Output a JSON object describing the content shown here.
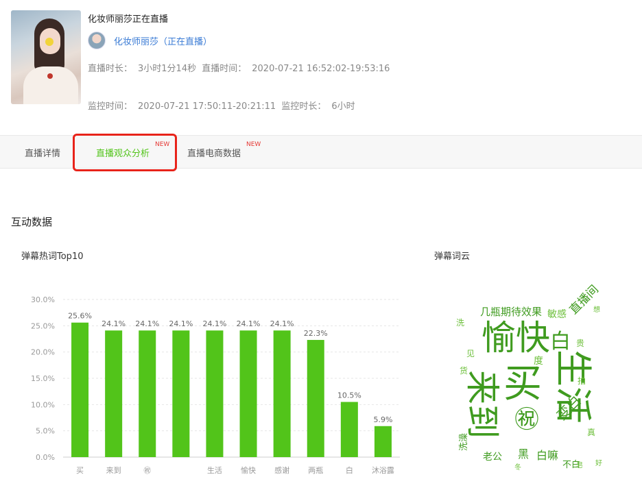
{
  "header": {
    "title": "化妆师丽莎正在直播",
    "anchor_name": "化妆师丽莎（正在直播）",
    "live_duration_label": "直播时长：",
    "live_duration": "3小时1分14秒",
    "live_time_label": "直播时间：",
    "live_time": "2020-07-21 16:52:02-19:53:16",
    "monitor_time_label": "监控时间：",
    "monitor_time": "2020-07-21 17:50:11-20:21:11",
    "monitor_duration_label": "监控时长：",
    "monitor_duration": "6小时"
  },
  "tabs": [
    {
      "label": "直播详情",
      "badge": ""
    },
    {
      "label": "直播观众分析",
      "badge": "NEW"
    },
    {
      "label": "直播电商数据",
      "badge": "NEW"
    }
  ],
  "section": {
    "title": "互动数据",
    "chart_title": "弹幕热词Top10",
    "cloud_title": "弹幕词云"
  },
  "colors": {
    "accent": "#52c41a",
    "link": "#3a7bd5",
    "highlight": "#e8231a",
    "cloud_dark": "#3f9b1f",
    "cloud_light": "#6cbf3a"
  },
  "chart_data": {
    "type": "bar",
    "categories": [
      "买",
      "来到",
      "㊗",
      "",
      "生活",
      "愉快",
      "感谢",
      "两瓶",
      "白",
      "沐浴露"
    ],
    "values": [
      25.6,
      24.1,
      24.1,
      24.1,
      24.1,
      24.1,
      24.1,
      22.3,
      10.5,
      5.9
    ],
    "value_labels": [
      "25.6%",
      "24.1%",
      "24.1%",
      "24.1%",
      "24.1%",
      "24.1%",
      "24.1%",
      "22.3%",
      "10.5%",
      "5.9%"
    ],
    "y_ticks": [
      "0.0%",
      "5.0%",
      "10.0%",
      "15.0%",
      "20.0%",
      "25.0%",
      "30.0%"
    ],
    "ylim": [
      0,
      30
    ],
    "grid": true,
    "bar_color": "#52c41a"
  },
  "word_cloud": [
    {
      "text": "愉快",
      "size": 50,
      "weight": "dark"
    },
    {
      "text": "买",
      "size": 56,
      "weight": "dark"
    },
    {
      "text": "来到",
      "size": 50,
      "weight": "dark",
      "rotate": 90
    },
    {
      "text": "生活",
      "size": 54,
      "weight": "dark",
      "rotate": 90
    },
    {
      "text": "几瓶期待效果",
      "size": 15,
      "weight": "dark"
    },
    {
      "text": "敏感",
      "size": 14,
      "weight": "light"
    },
    {
      "text": "直播间",
      "size": 17,
      "weight": "dark",
      "rotate": -45
    },
    {
      "text": "白",
      "size": 30,
      "weight": "dark"
    },
    {
      "text": "度",
      "size": 14,
      "weight": "light"
    },
    {
      "text": "㊗",
      "size": 36,
      "weight": "dark"
    },
    {
      "text": "变白",
      "size": 20,
      "weight": "dark",
      "rotate": -45
    },
    {
      "text": "白嘛",
      "size": 16,
      "weight": "dark"
    },
    {
      "text": "老公",
      "size": 14,
      "weight": "dark"
    },
    {
      "text": "洗澡",
      "size": 13,
      "weight": "dark",
      "rotate": -90
    },
    {
      "text": "不白",
      "size": 13,
      "weight": "dark"
    },
    {
      "text": "拍",
      "size": 12,
      "weight": "light"
    },
    {
      "text": "真",
      "size": 12,
      "weight": "light"
    },
    {
      "text": "见",
      "size": 12,
      "weight": "light"
    },
    {
      "text": "货",
      "size": 12,
      "weight": "light"
    },
    {
      "text": "洗",
      "size": 12,
      "weight": "light"
    },
    {
      "text": "贵",
      "size": 12,
      "weight": "light"
    },
    {
      "text": "黑",
      "size": 16,
      "weight": "dark"
    },
    {
      "text": "冬",
      "size": 10,
      "weight": "light"
    },
    {
      "text": "皂",
      "size": 10,
      "weight": "light"
    },
    {
      "text": "想",
      "size": 10,
      "weight": "light"
    },
    {
      "text": "好",
      "size": 10,
      "weight": "light"
    }
  ]
}
